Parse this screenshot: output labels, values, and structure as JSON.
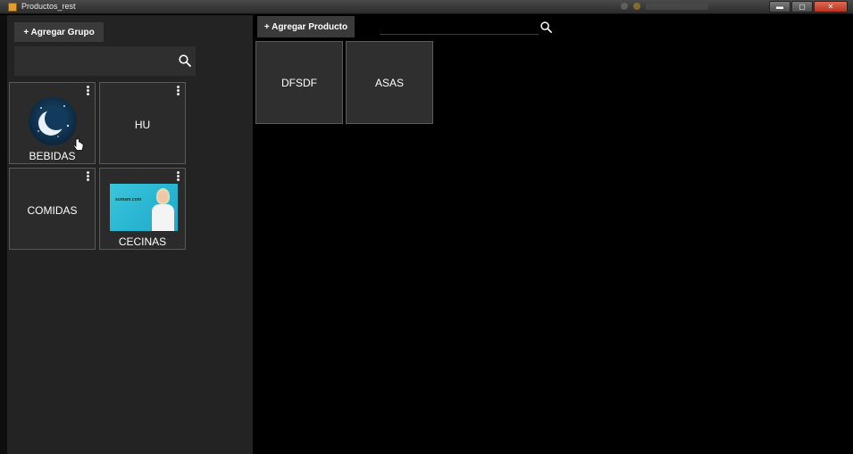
{
  "window": {
    "title": "Productos_rest",
    "buttons": {
      "minimize": "▬",
      "maximize": "▢",
      "close": "✕"
    }
  },
  "groups_panel": {
    "add_button_label": "+ Agregar Grupo",
    "search": {
      "value": "",
      "placeholder": ""
    },
    "groups": [
      {
        "label": "BEBIDAS",
        "image": "moon-night-image"
      },
      {
        "label": "HU",
        "image": null
      },
      {
        "label": "COMIDAS",
        "image": null
      },
      {
        "label": "CECINAS",
        "image": "woman-advertisement-image",
        "image_text": "sumam.com"
      }
    ]
  },
  "products_panel": {
    "add_button_label": "+ Agregar Producto",
    "search": {
      "value": "",
      "placeholder": ""
    },
    "products": [
      {
        "label": "DFSDF"
      },
      {
        "label": "ASAS"
      }
    ]
  },
  "colors": {
    "window_bg": "#000000",
    "panel_bg": "#232323",
    "tile_bg": "#2b2b2b",
    "button_bg": "#3a3a3a",
    "text": "#ffffff"
  }
}
